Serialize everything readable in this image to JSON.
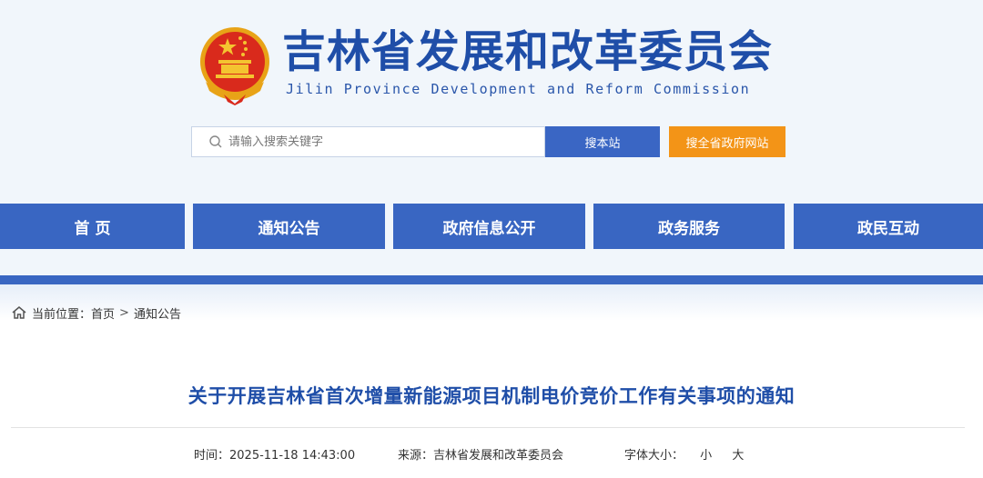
{
  "header": {
    "title": "吉林省发展和改革委员会",
    "subtitle": "Jilin Province Development and Reform Commission",
    "emblem_icon": "national-emblem-icon"
  },
  "search": {
    "placeholder": "请输入搜索关键字",
    "search_site_label": "搜本站",
    "search_all_label": "搜全省政府网站"
  },
  "nav": {
    "items": [
      {
        "label": "首 页"
      },
      {
        "label": "通知公告"
      },
      {
        "label": "政府信息公开"
      },
      {
        "label": "政务服务"
      },
      {
        "label": "政民互动"
      }
    ]
  },
  "breadcrumb": {
    "prefix": "当前位置：",
    "home": "首页",
    "separator": ">",
    "current": "通知公告"
  },
  "article": {
    "title": "关于开展吉林省首次增量新能源项目机制电价竞价工作有关事项的通知",
    "time_label": "时间：",
    "time_value": "2025-11-18 14:43:00",
    "source_label": "来源：",
    "source_value": "吉林省发展和改革委员会",
    "font_size_label": "字体大小：",
    "font_small": "小",
    "font_large": "大"
  },
  "colors": {
    "primary": "#3966c2",
    "title_blue": "#1f4ea8",
    "accent_orange": "#f39417",
    "header_bg": "#f1f6fb"
  }
}
